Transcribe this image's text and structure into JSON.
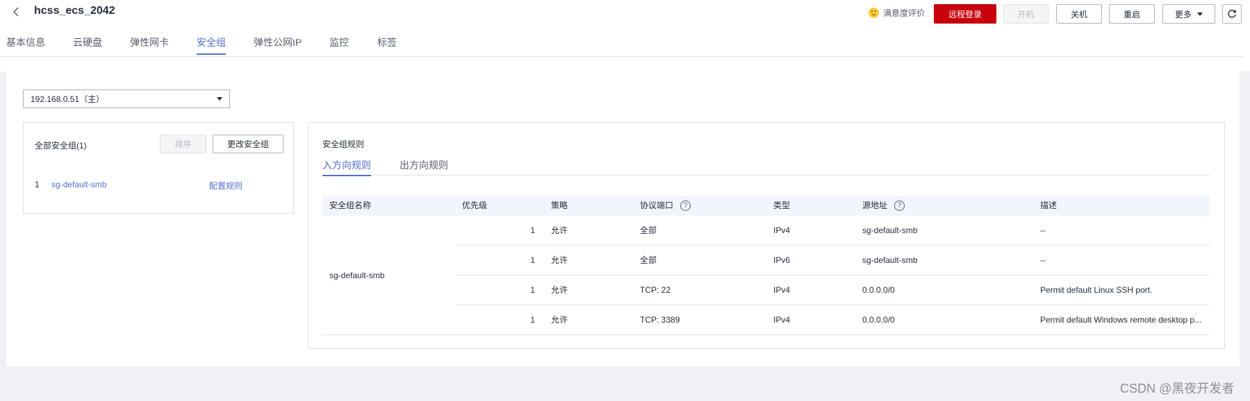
{
  "header": {
    "title": "hcss_ecs_2042",
    "satisfaction_label": "满意度评价",
    "buttons": {
      "remote_login": "远程登录",
      "power_on": "开机",
      "power_off": "关机",
      "restart": "重启",
      "more": "更多"
    }
  },
  "tabs": [
    "基本信息",
    "云硬盘",
    "弹性网卡",
    "安全组",
    "弹性公网IP",
    "监控",
    "标签"
  ],
  "active_tab": "安全组",
  "nic_select": {
    "value": "192.168.0.51（主）"
  },
  "sg_panel": {
    "title": "全部安全组(1)",
    "sort_button": "排序",
    "change_button": "更改安全组",
    "items": [
      {
        "index": "1",
        "name": "sg-default-smb",
        "action": "配置规则"
      }
    ]
  },
  "rules_panel": {
    "title": "安全组规则",
    "subtabs": [
      "入方向规则",
      "出方向规则"
    ],
    "columns": [
      "安全组名称",
      "优先级",
      "策略",
      "协议端口",
      "类型",
      "源地址",
      "描述"
    ],
    "group_name": "sg-default-smb",
    "rows": [
      {
        "priority": "1",
        "policy": "允许",
        "protocol": "全部",
        "type": "IPv4",
        "source": "sg-default-smb",
        "description": "--"
      },
      {
        "priority": "1",
        "policy": "允许",
        "protocol": "全部",
        "type": "IPv6",
        "source": "sg-default-smb",
        "description": "--"
      },
      {
        "priority": "1",
        "policy": "允许",
        "protocol": "TCP: 22",
        "type": "IPv4",
        "source": "0.0.0.0/0",
        "description": "Permit default Linux SSH port."
      },
      {
        "priority": "1",
        "policy": "允许",
        "protocol": "TCP: 3389",
        "type": "IPv4",
        "source": "0.0.0.0/0",
        "description": "Permit default Windows remote desktop p..."
      }
    ]
  },
  "watermark": "CSDN @黑夜开发者",
  "colors": {
    "brand_red": "#c7000b",
    "link_blue": "#526ecc",
    "header_bg": "#f2f5fc"
  }
}
